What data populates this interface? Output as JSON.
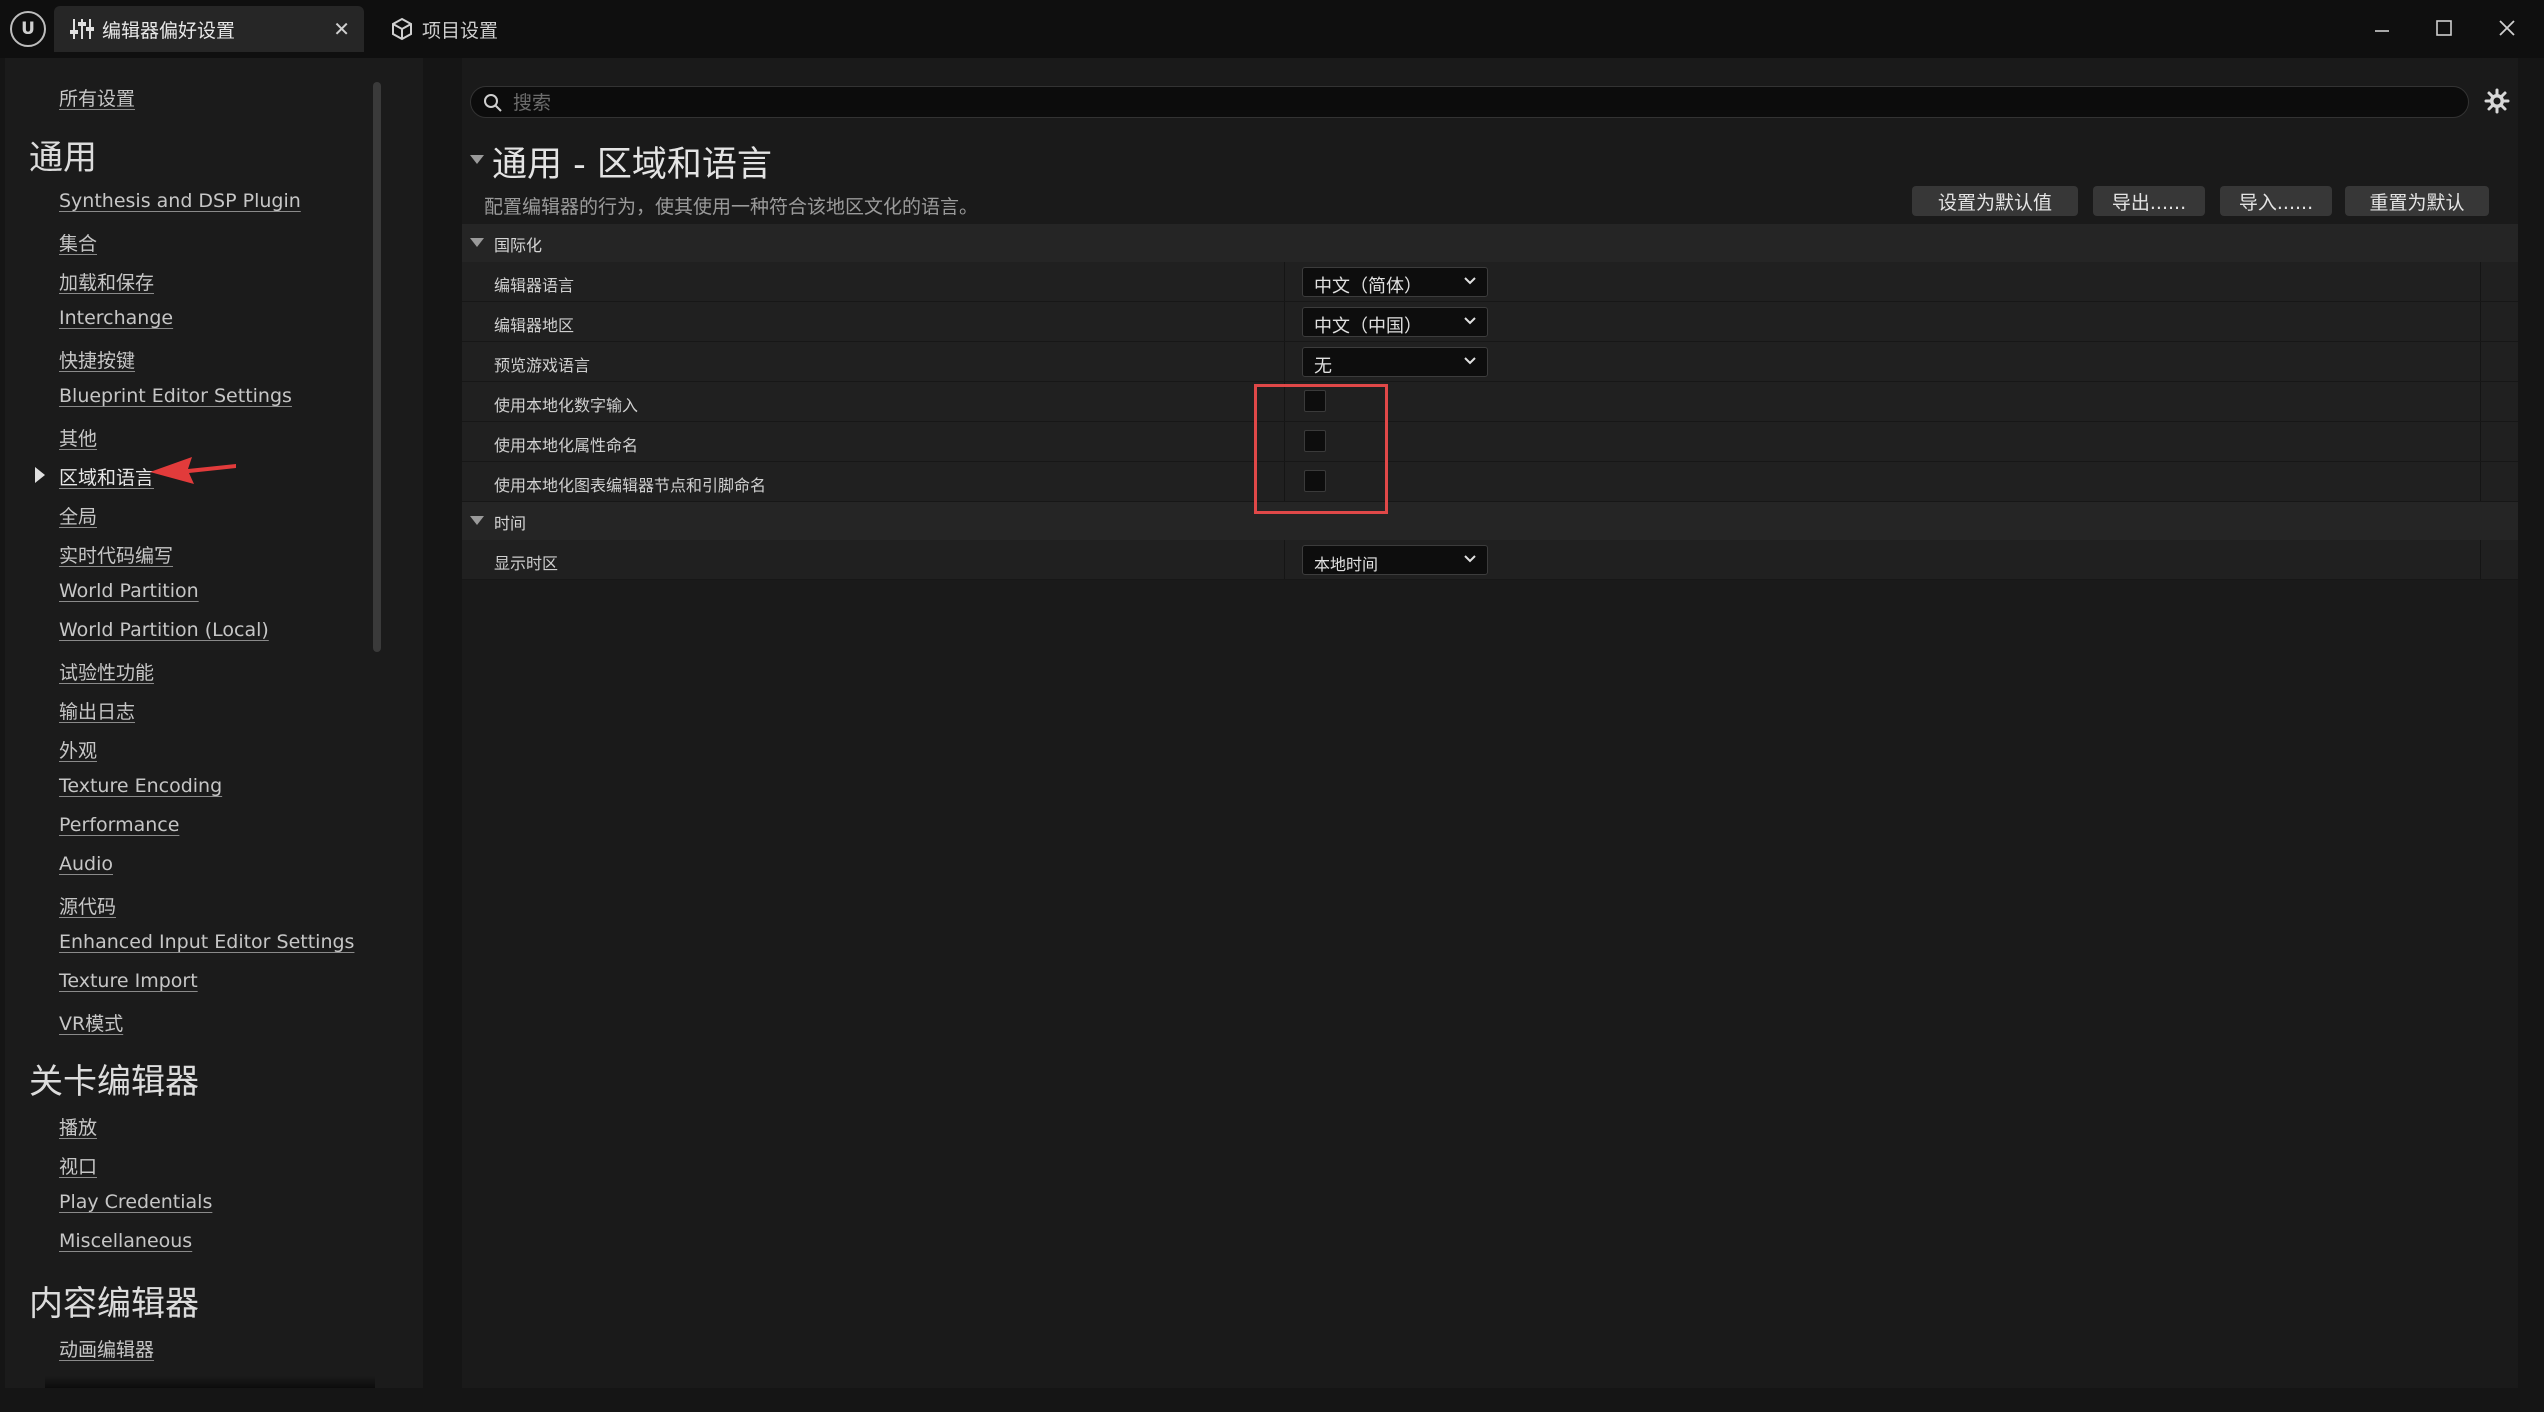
{
  "window": {
    "tabs": [
      {
        "label": "编辑器偏好设置",
        "icon": "sliders-icon",
        "active": true
      },
      {
        "label": "项目设置",
        "icon": "cube-settings-icon",
        "active": false
      }
    ],
    "logo_text": "U",
    "controls": [
      "minimize-icon",
      "maximize-icon",
      "close-icon"
    ]
  },
  "sidebar": {
    "all_settings": "所有设置",
    "sections": [
      {
        "title": "通用",
        "items": [
          "Synthesis and DSP Plugin",
          "集合",
          "加载和保存",
          "Interchange",
          "快捷按键",
          "Blueprint Editor Settings",
          "其他",
          "区域和语言",
          "全局",
          "实时代码编写",
          "World Partition",
          "World Partition (Local)",
          "试验性功能",
          "输出日志",
          "外观",
          "Texture Encoding",
          "Performance",
          "Audio",
          "源代码",
          "Enhanced Input Editor Settings",
          "Texture Import",
          "VR模式"
        ]
      },
      {
        "title": "关卡编辑器",
        "items": [
          "播放",
          "视口",
          "Play Credentials",
          "Miscellaneous"
        ]
      },
      {
        "title": "内容编辑器",
        "items": [
          "动画编辑器"
        ]
      }
    ],
    "selected_item": "区域和语言"
  },
  "main": {
    "search": {
      "placeholder": "搜索",
      "value": ""
    },
    "title": "通用 - 区域和语言",
    "description": "配置编辑器的行为，使其使用一种符合该地区文化的语言。",
    "buttons": {
      "set_default": "设置为默认值",
      "export": "导出......",
      "import": "导入......",
      "reset": "重置为默认"
    },
    "categories": [
      {
        "name": "国际化",
        "properties": [
          {
            "label": "编辑器语言",
            "type": "dropdown",
            "value": "中文（简体）"
          },
          {
            "label": "编辑器地区",
            "type": "dropdown",
            "value": "中文（中国）"
          },
          {
            "label": "预览游戏语言",
            "type": "dropdown",
            "value": "无"
          },
          {
            "label": "使用本地化数字输入",
            "type": "checkbox",
            "checked": false
          },
          {
            "label": "使用本地化属性命名",
            "type": "checkbox",
            "checked": false
          },
          {
            "label": "使用本地化图表编辑器节点和引脚命名",
            "type": "checkbox",
            "checked": false
          }
        ]
      },
      {
        "name": "时间",
        "properties": [
          {
            "label": "显示时区",
            "type": "dropdown",
            "value": "本地时间"
          }
        ]
      }
    ]
  },
  "colors": {
    "highlight": "#e04848",
    "annotation_arrow": "#e23b3b",
    "background": "#151515"
  }
}
